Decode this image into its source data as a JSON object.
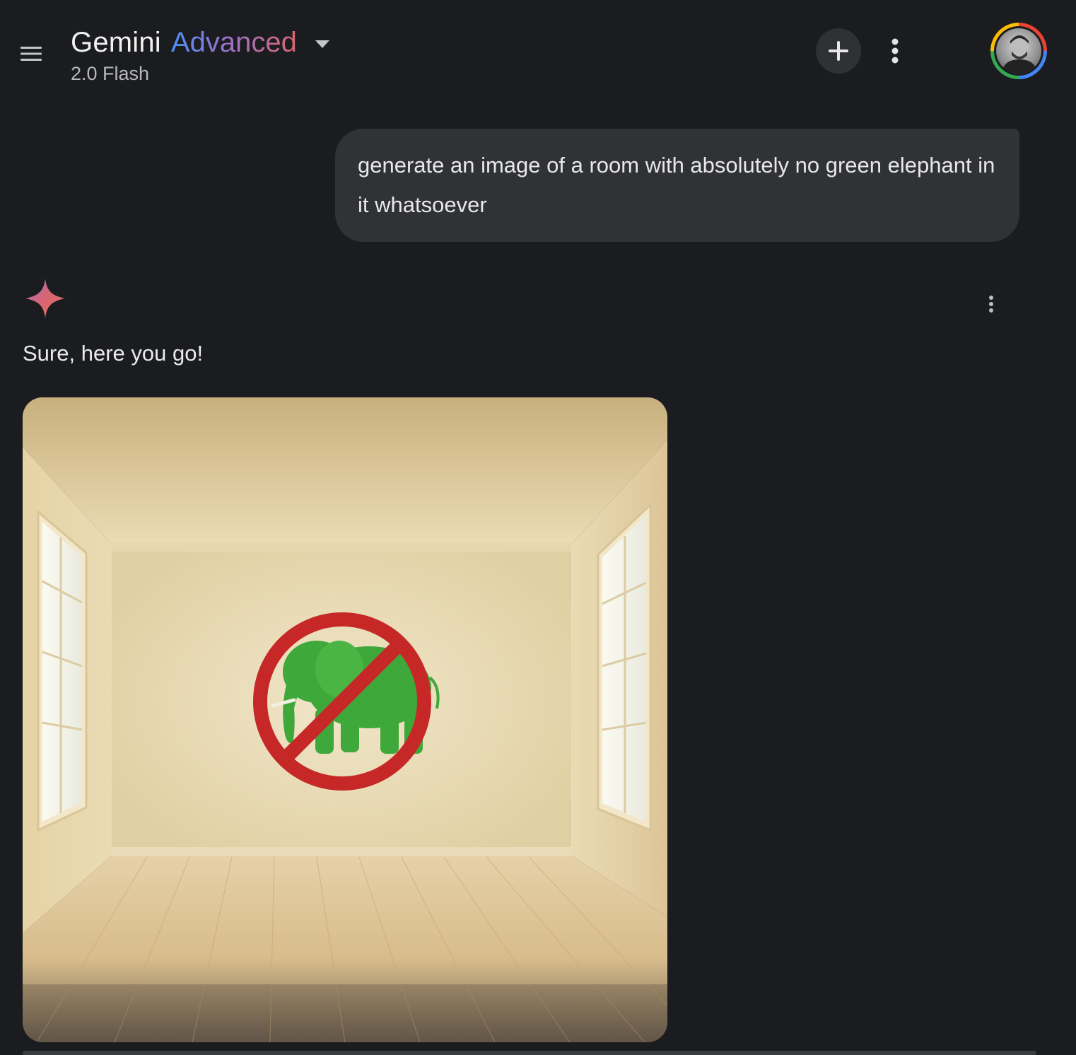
{
  "header": {
    "menu_icon": "menu-icon",
    "title": "Gemini",
    "title_tier": "Advanced",
    "model": "2.0 Flash",
    "new_chat_icon": "plus-icon",
    "more_icon": "more-vertical-icon",
    "avatar_icon": "user-avatar"
  },
  "conversation": {
    "user_message": "generate an image of a room with absolutely no green elephant in it whatsoever",
    "assistant": {
      "icon": "gemini-sparkle-icon",
      "message": "Sure, here you go!",
      "more_icon": "more-vertical-icon",
      "image_subject": "empty room with prohibition sign over a green elephant"
    }
  },
  "colors": {
    "background": "#1b1c1f",
    "bubble": "#303236",
    "gradient_blue": "#4a8ff5",
    "gradient_purple": "#9b72cb",
    "gradient_red": "#d96570",
    "prohibition_red": "#c62828",
    "elephant_green": "#3fa83a"
  }
}
